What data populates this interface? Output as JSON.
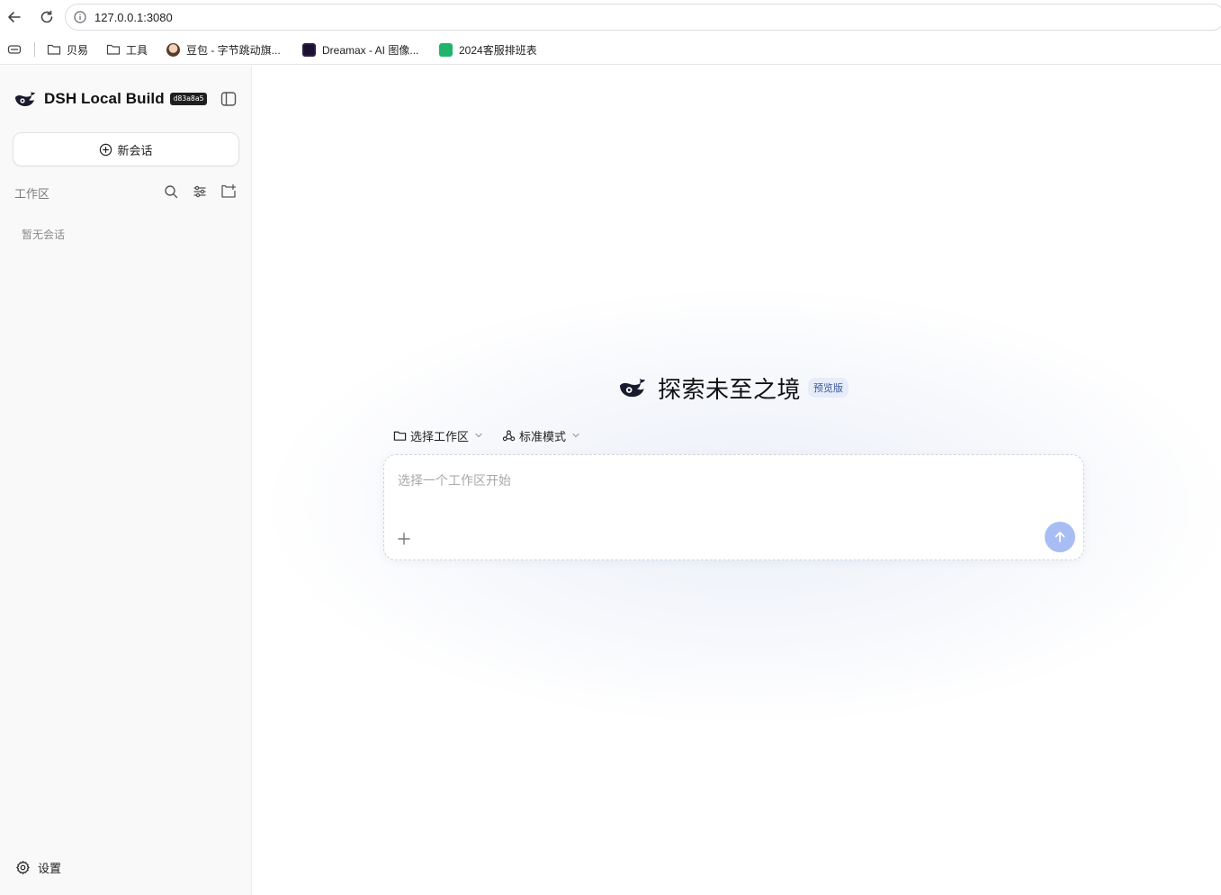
{
  "browser": {
    "url": "127.0.0.1:3080",
    "back_icon": "arrow-left-icon",
    "reload_icon": "reload-icon",
    "bookmarks": [
      {
        "label": "贝易",
        "icon": "folder-icon"
      },
      {
        "label": "工具",
        "icon": "folder-icon"
      },
      {
        "label": "豆包 - 字节跳动旗...",
        "icon": "doubao-favicon"
      },
      {
        "label": "Dreamax - AI 图像...",
        "icon": "dreamax-favicon"
      },
      {
        "label": "2024客服排班表",
        "icon": "sheet-favicon"
      }
    ]
  },
  "sidebar": {
    "brand_name": "DSH Local Build",
    "brand_badge": "d83a8a5",
    "new_chat_label": "新会话",
    "workspace_label": "工作区",
    "empty_hint": "暂无会话",
    "settings_label": "设置"
  },
  "main": {
    "hero_title": "探索未至之境",
    "hero_badge": "预览版",
    "workspace_select_label": "选择工作区",
    "mode_select_label": "标准模式",
    "composer_placeholder": "选择一个工作区开始"
  },
  "colors": {
    "accent": "#a9bdf5",
    "badge_bg": "#e6ecf9",
    "sidebar_bg": "#f9f9fa"
  }
}
